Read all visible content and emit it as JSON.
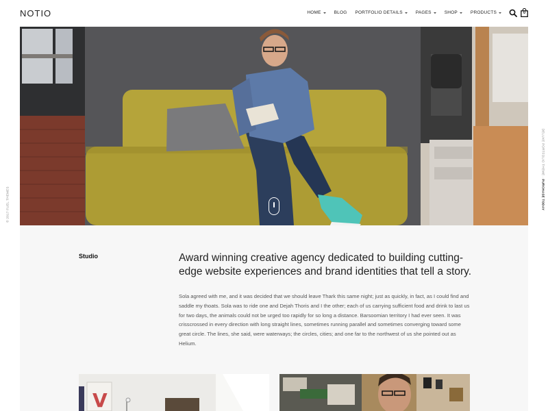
{
  "header": {
    "logo": "NOTIO",
    "nav": [
      {
        "label": "HOME",
        "dropdown": true
      },
      {
        "label": "BLOG",
        "dropdown": false
      },
      {
        "label": "PORTFOLIO DETAILS",
        "dropdown": true
      },
      {
        "label": "PAGES",
        "dropdown": true
      },
      {
        "label": "SHOP",
        "dropdown": true
      },
      {
        "label": "PRODUCTS",
        "dropdown": true
      }
    ],
    "cart_count": "0"
  },
  "side": {
    "left_text": "© 2017 FUEL THEMES",
    "right_prefix": "DELUXE PORTFOLIO THEME · ",
    "right_cta": "PURCHASE TODAY"
  },
  "hero": {
    "image": "man-on-yellow-sofa-writing"
  },
  "studio": {
    "label": "Studio",
    "headline": "Award winning creative agency dedicated to building cutting-edge website experiences and brand identities that tell a story.",
    "body": "Sola agreed with me, and it was decided that we should leave Thark this same night; just as quickly, in fact, as I could find and saddle my thoats. Sola was to ride one and Dejah Thoris and I the other; each of us carrying sufficient food and drink to last us for two days, the animals could not be urged too rapidly for so long a distance. Barsoomian territory I had ever seen. It was crisscrossed in every direction with long straight lines, sometimes running parallel and sometimes converging toward some great circle. The lines, she said, were waterways; the circles, cities; and one far to the northwest of us she pointed out as Helium."
  },
  "colors": {
    "sofa": "#b5a43a",
    "shirt": "#5d7aa8",
    "jeans": "#2c3e5c",
    "shoes": "#4fc4b8",
    "content_bg": "#f7f7f7"
  }
}
